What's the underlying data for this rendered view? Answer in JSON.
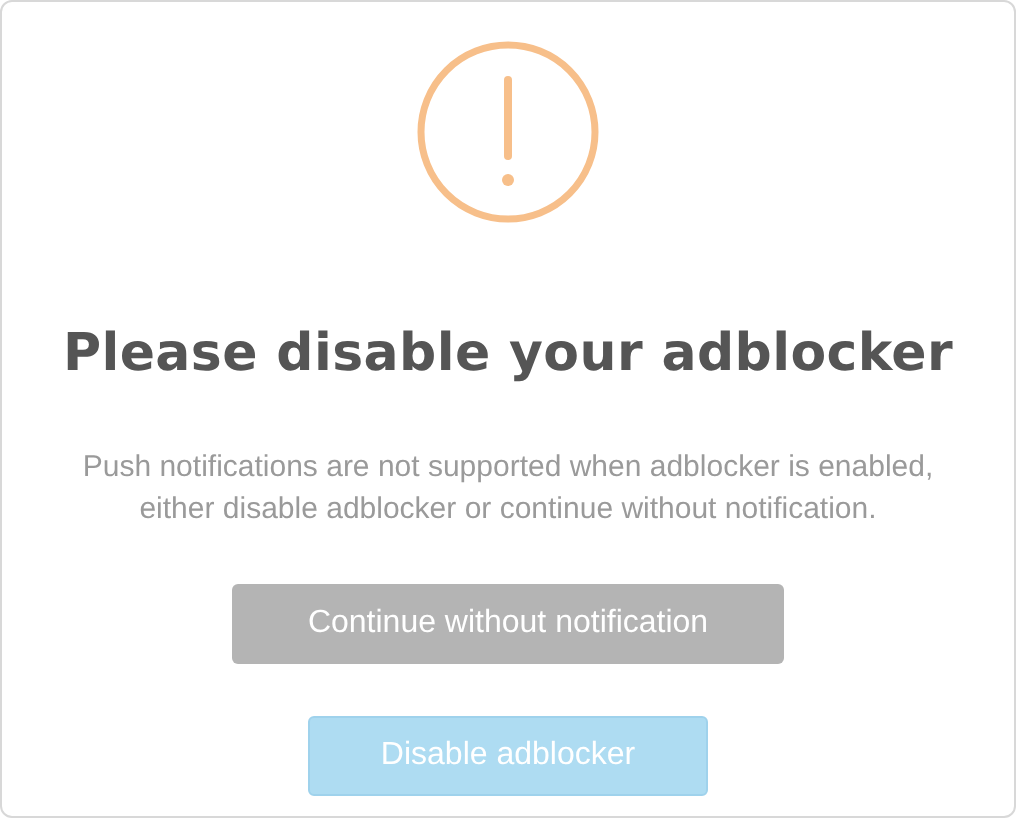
{
  "dialog": {
    "title": "Please disable your adblocker",
    "message": "Push notifications are not supported when adblocker is enabled, either disable adblocker or continue without notification.",
    "buttons": [
      {
        "label": "Continue without notification",
        "kind": "secondary"
      },
      {
        "label": "Disable adblocker",
        "kind": "primary"
      }
    ]
  }
}
